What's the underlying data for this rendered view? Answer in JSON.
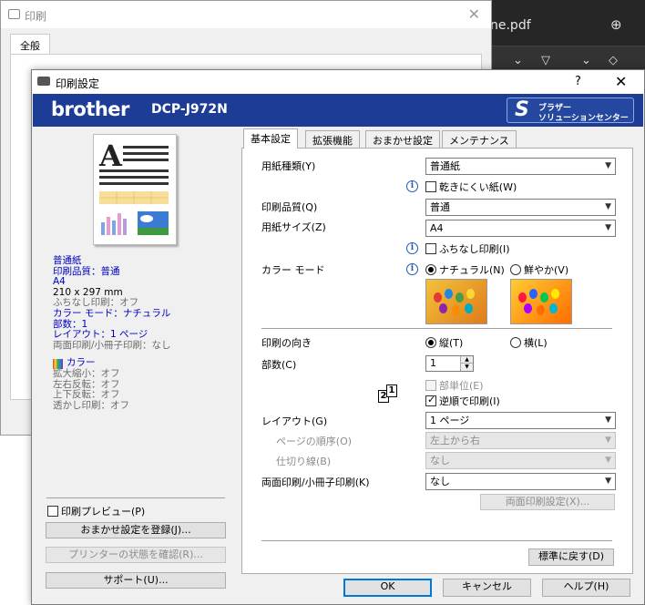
{
  "background": {
    "pdf_tab_title": "ne.pdf",
    "back_window_title": "印刷",
    "back_window_tab": "全般",
    "back_window_close": "✕"
  },
  "dialog": {
    "title": "印刷設定",
    "help_label": "?",
    "close_label": "✕",
    "brand": "brother",
    "model": "DCP-J972N",
    "solutions_center": {
      "line1": "ブラザー",
      "line2": "ソリューションセンター"
    }
  },
  "summary": {
    "blue_lines": [
      "普通紙",
      "印刷品質：普通",
      "A4"
    ],
    "size": "210 x 297 mm",
    "borderless": "ふちなし印刷：オフ",
    "blue_lines2": [
      "カラー モード：ナチュラル",
      "部数：1",
      "レイアウト：1 ページ"
    ],
    "duplex": "両面印刷/小冊子印刷：なし",
    "color_label": "カラー",
    "gray_lines": [
      "拡大縮小：オフ",
      "左右反転：オフ",
      "上下反転：オフ",
      "透かし印刷：オフ"
    ]
  },
  "left_controls": {
    "print_preview": "印刷プレビュー(P)",
    "save_settings": "おまかせ設定を登録(J)...",
    "printer_status": "プリンターの状態を確認(R)...",
    "support": "サポート(U)..."
  },
  "tabs": [
    "基本設定",
    "拡張機能",
    "おまかせ設定",
    "メンテナンス"
  ],
  "basic": {
    "media_type_label": "用紙種類(Y)",
    "media_type_value": "普通紙",
    "slow_dry_label": "乾きにくい紙(W)",
    "quality_label": "印刷品質(Q)",
    "quality_value": "普通",
    "paper_size_label": "用紙サイズ(Z)",
    "paper_size_value": "A4",
    "borderless_label": "ふちなし印刷(I)",
    "color_mode_label": "カラー モード",
    "color_natural": "ナチュラル(N)",
    "color_vivid": "鮮やか(V)",
    "orientation_label": "印刷の向き",
    "portrait": "縦(T)",
    "landscape": "横(L)",
    "copies_label": "部数(C)",
    "copies_value": "1",
    "collate_label": "部単位(E)",
    "reverse_label": "逆順で印刷(I)",
    "layout_label": "レイアウト(G)",
    "layout_value": "1 ページ",
    "page_order_label": "ページの順序(O)",
    "page_order_value": "左上から右",
    "border_line_label": "仕切り線(B)",
    "border_line_value": "なし",
    "duplex_label": "両面印刷/小冊子印刷(K)",
    "duplex_value": "なし",
    "duplex_settings": "両面印刷設定(X)...",
    "default_button": "標準に戻す(D)"
  },
  "footer": {
    "ok": "OK",
    "cancel": "キャンセル",
    "help": "ヘルプ(H)"
  }
}
